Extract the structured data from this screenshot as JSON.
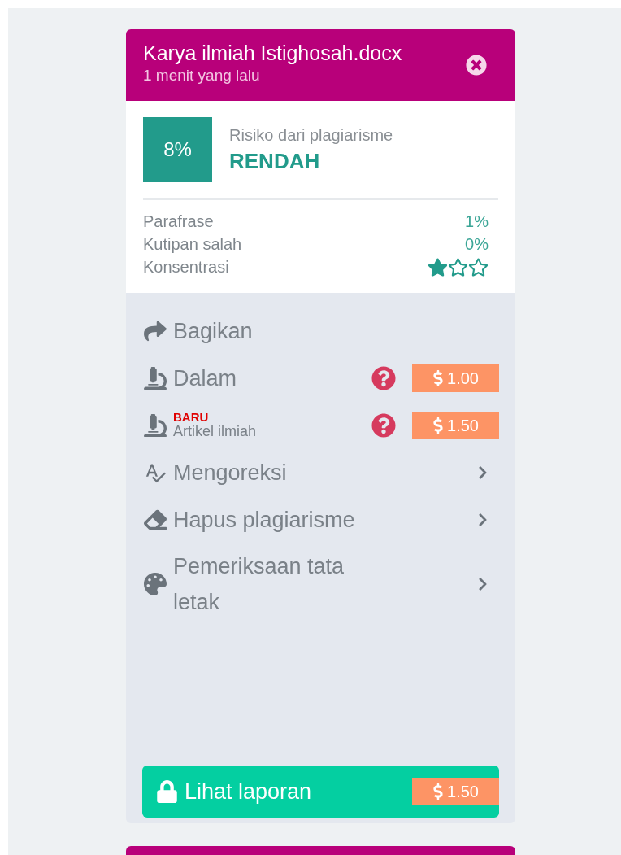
{
  "document": {
    "title": "Karya ilmiah Istighosah.docx",
    "time": "1 menit yang lalu"
  },
  "risk": {
    "percent": "8%",
    "label": "Risiko dari plagiarisme",
    "level_text": "RENDAH"
  },
  "metrics": [
    {
      "kind": "value",
      "label": "Parafrase",
      "value": "1%"
    },
    {
      "kind": "value",
      "label": "Kutipan salah",
      "value": "0%"
    },
    {
      "kind": "stars",
      "label": "Konsentrasi",
      "stars": 1
    }
  ],
  "actions": [
    {
      "kind": "plain",
      "label": "Bagikan"
    },
    {
      "kind": "priced",
      "label": "Dalam",
      "price": "1.00"
    },
    {
      "kind": "priced",
      "label": "Artikel ilmiah",
      "badge": "BARU",
      "price": "1.50"
    },
    {
      "kind": "link",
      "label": "Mengoreksi"
    },
    {
      "kind": "link",
      "label": "Hapus plagiarisme"
    },
    {
      "kind": "link",
      "label": "Pemeriksaan tata letak"
    }
  ],
  "report_button": {
    "label": "Lihat laporan",
    "price": "1.50"
  }
}
